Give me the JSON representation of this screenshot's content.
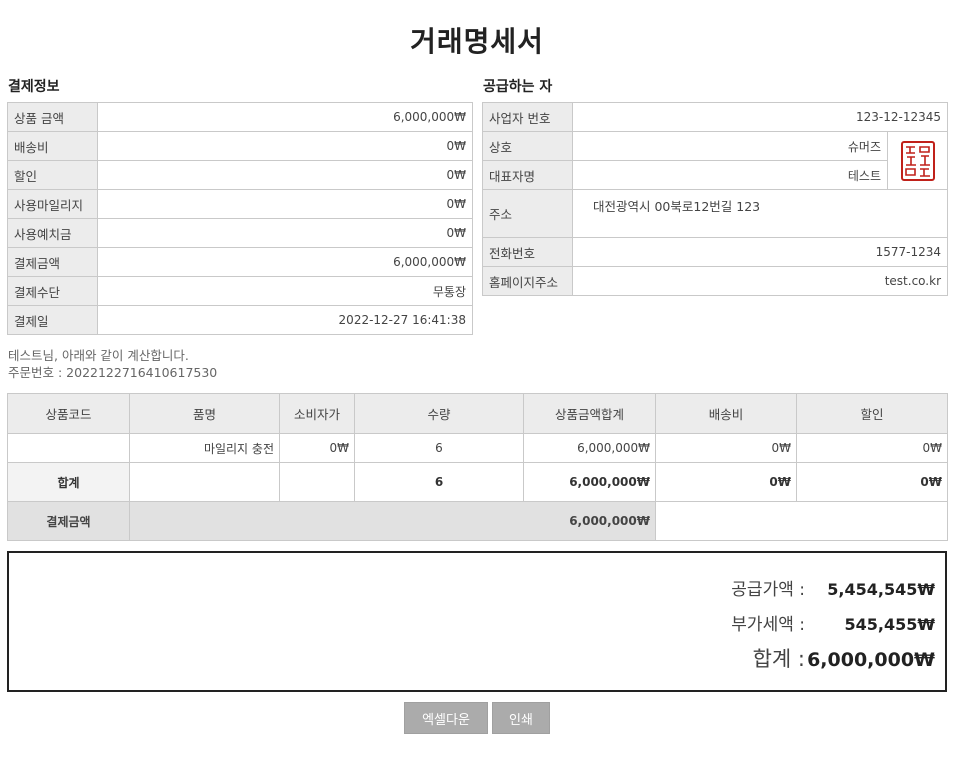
{
  "doc_title": "거래명세서",
  "payment": {
    "section_title": "결제정보",
    "rows": [
      {
        "label": "상품 금액",
        "value": "6,000,000₩"
      },
      {
        "label": "배송비",
        "value": "0₩"
      },
      {
        "label": "할인",
        "value": "0₩"
      },
      {
        "label": "사용마일리지",
        "value": "0₩"
      },
      {
        "label": "사용예치금",
        "value": "0₩"
      },
      {
        "label": "결제금액",
        "value": "6,000,000₩"
      },
      {
        "label": "결제수단",
        "value": "무통장"
      },
      {
        "label": "결제일",
        "value": "2022-12-27 16:41:38"
      }
    ]
  },
  "supplier": {
    "section_title": "공급하는 자",
    "biz_no": {
      "label": "사업자 번호",
      "value": "123-12-12345"
    },
    "company": {
      "label": "상호",
      "value": "슈머즈"
    },
    "ceo": {
      "label": "대표자명",
      "value": "테스트"
    },
    "address": {
      "label": "주소",
      "value": "대전광역시 00북로12번길 123"
    },
    "phone": {
      "label": "전화번호",
      "value": "1577-1234"
    },
    "homepage": {
      "label": "홈페이지주소",
      "value": "test.co.kr"
    },
    "seal": {
      "text": "회사명의인",
      "color": "#c0211a"
    }
  },
  "greeting": {
    "line1": "테스트님, 아래와 같이 계산합니다.",
    "line2": "주문번호 : 2022122716410617530"
  },
  "items": {
    "headers": [
      "상품코드",
      "품명",
      "소비자가",
      "수량",
      "상품금액합계",
      "배송비",
      "할인"
    ],
    "rows": [
      {
        "code": "",
        "name": "마일리지 충전",
        "price": "0₩",
        "qty": "6",
        "subtotal": "6,000,000₩",
        "shipping": "0₩",
        "discount": "0₩"
      }
    ],
    "sum": {
      "label": "합계",
      "qty": "6",
      "subtotal": "6,000,000₩",
      "shipping": "0₩",
      "discount": "0₩"
    },
    "pay": {
      "label": "결제금액",
      "amount": "6,000,000₩"
    }
  },
  "totals": {
    "supply": {
      "label": "공급가액 :",
      "value": "5,454,545₩"
    },
    "vat": {
      "label": "부가세액 :",
      "value": "545,455₩"
    },
    "total": {
      "label": "합계 :",
      "value": "6,000,000₩"
    }
  },
  "buttons": {
    "excel": "엑셀다운",
    "print": "인쇄"
  }
}
